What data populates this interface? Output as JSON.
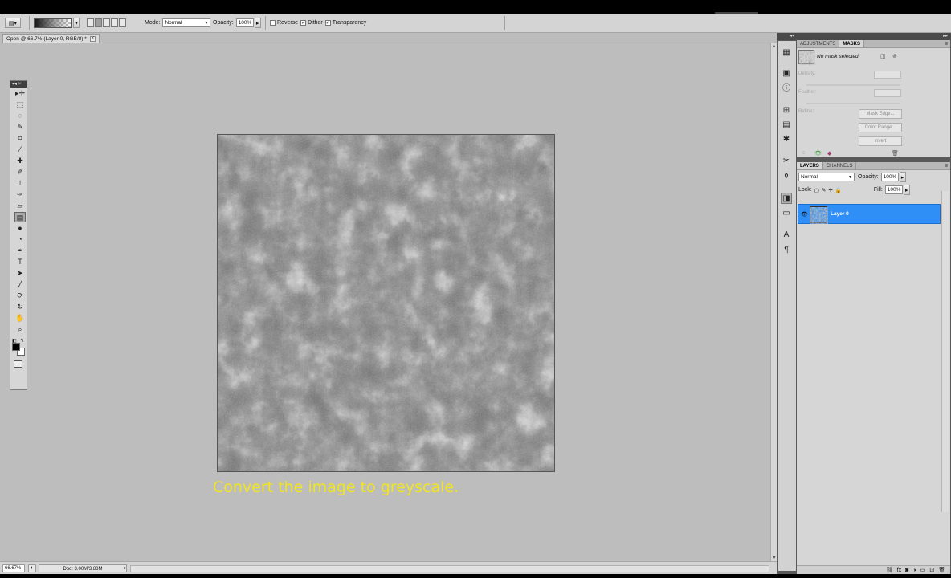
{
  "app": {
    "document_tab": "Open @ 66.7% (Layer 0, RGB/8) *"
  },
  "options_bar": {
    "mode_label": "Mode:",
    "mode_value": "Normal",
    "opacity_label": "Opacity:",
    "opacity_value": "100%",
    "reverse_label": "Reverse",
    "reverse_checked": false,
    "dither_label": "Dither",
    "dither_checked": true,
    "transparency_label": "Transparency",
    "transparency_checked": true,
    "checked_mark": "✓",
    "unchecked_mark": ""
  },
  "canvas": {
    "caption": "Convert the image to greyscale.",
    "caption_color": "#f1e421",
    "texture_icon": "stone-texture-image"
  },
  "status_bar": {
    "zoom": "66.67%",
    "doc_size": "Doc: 3.00M/3.88M"
  },
  "masks_panel": {
    "tabs": [
      "ADJUSTMENTS",
      "MASKS"
    ],
    "active_tab": "MASKS",
    "no_mask": "No mask selected",
    "density_label": "Density:",
    "feather_label": "Feather:",
    "refine_label": "Refine:",
    "mask_edge_button": "Mask Edge...",
    "color_range_button": "Color Range...",
    "invert_button": "Invert"
  },
  "layers_panel": {
    "tabs": [
      "LAYERS",
      "CHANNELS"
    ],
    "active_tab": "LAYERS",
    "blend_mode": "Normal",
    "opacity_label": "Opacity:",
    "opacity_value": "100%",
    "lock_label": "Lock:",
    "fill_label": "Fill:",
    "fill_value": "100%",
    "layers": [
      {
        "name": "Layer 0",
        "selected": true,
        "visible": true
      }
    ]
  },
  "colors": {
    "selected_layer": "#2f8ff7",
    "foreground": "#000000",
    "background": "#ffffff"
  }
}
